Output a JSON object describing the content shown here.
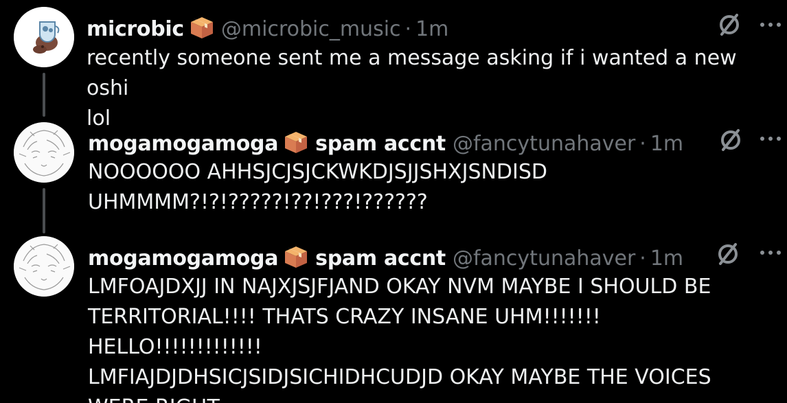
{
  "posts": [
    {
      "name": "microbic",
      "handle": "@microbic_music",
      "separator": "·",
      "time": "1m",
      "text": "recently someone sent me a message asking if i wanted a new oshi\nlol",
      "avatar_icon": "bird-in-teacup-avatar",
      "badge_icon": "box-emoji-icon"
    },
    {
      "name": "mogamogamoga",
      "display_suffix": "spam accnt",
      "handle": "@fancytunahaver",
      "separator": "·",
      "time": "1m",
      "text": "NOOOOOO AHHSJCJSJCKWKDJSJJSHXJSNDISD\nUHMMMM?!?!?????!??!???!??????",
      "avatar_icon": "anime-sketch-avatar",
      "badge_icon": "box-emoji-icon"
    },
    {
      "name": "mogamogamoga",
      "display_suffix": "spam accnt",
      "handle": "@fancytunahaver",
      "separator": "·",
      "time": "1m",
      "text": "LMFOAJDXJJ IN NAJXJSJFJAND OKAY NVM MAYBE I SHOULD BE\nTERRITORIAL!!!! THATS CRAZY INSANE UHM!!!!!!! HELLO!!!!!!!!!!!!!\nLMFIAJDJDHSICJSIDJSICHIDHCUDJD OKAY MAYBE THE VOICES\nWERE RIGHT",
      "avatar_icon": "anime-sketch-avatar",
      "badge_icon": "box-emoji-icon"
    }
  ],
  "colors": {
    "background": "#000000",
    "text": "#e7e9ea",
    "muted": "#71767b",
    "thread_line": "#4a4d50"
  },
  "icons": {
    "null": "null-set-icon",
    "more": "more-options-icon"
  }
}
